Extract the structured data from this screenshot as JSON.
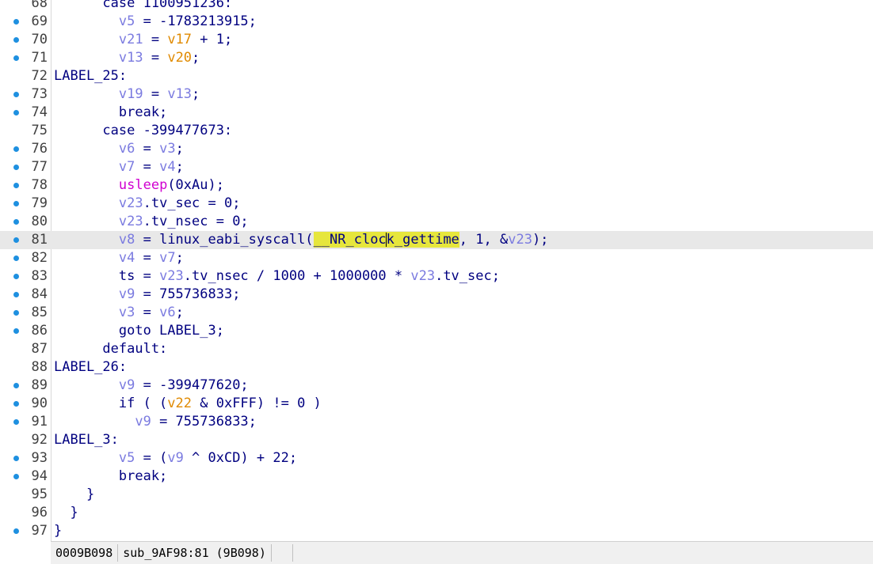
{
  "lines": [
    {
      "n": "68",
      "dot": false,
      "cur": false,
      "toks": [
        {
          "t": "      case 1100951236:",
          "c": ""
        }
      ]
    },
    {
      "n": "69",
      "dot": true,
      "cur": false,
      "toks": [
        {
          "t": "        ",
          "c": ""
        },
        {
          "t": "v5",
          "c": "ref"
        },
        {
          "t": " = -1783213915;",
          "c": ""
        }
      ]
    },
    {
      "n": "70",
      "dot": true,
      "cur": false,
      "toks": [
        {
          "t": "        ",
          "c": ""
        },
        {
          "t": "v21",
          "c": "ref"
        },
        {
          "t": " = ",
          "c": ""
        },
        {
          "t": "v17",
          "c": "val"
        },
        {
          "t": " + 1;",
          "c": ""
        }
      ]
    },
    {
      "n": "71",
      "dot": true,
      "cur": false,
      "toks": [
        {
          "t": "        ",
          "c": ""
        },
        {
          "t": "v13",
          "c": "ref"
        },
        {
          "t": " = ",
          "c": ""
        },
        {
          "t": "v20",
          "c": "val"
        },
        {
          "t": ";",
          "c": ""
        }
      ]
    },
    {
      "n": "72",
      "dot": false,
      "cur": false,
      "toks": [
        {
          "t": "LABEL_25:",
          "c": ""
        }
      ]
    },
    {
      "n": "73",
      "dot": true,
      "cur": false,
      "toks": [
        {
          "t": "        ",
          "c": ""
        },
        {
          "t": "v19",
          "c": "ref"
        },
        {
          "t": " = ",
          "c": ""
        },
        {
          "t": "v13",
          "c": "ref"
        },
        {
          "t": ";",
          "c": ""
        }
      ]
    },
    {
      "n": "74",
      "dot": true,
      "cur": false,
      "toks": [
        {
          "t": "        break;",
          "c": ""
        }
      ]
    },
    {
      "n": "75",
      "dot": false,
      "cur": false,
      "toks": [
        {
          "t": "      case -399477673:",
          "c": ""
        }
      ]
    },
    {
      "n": "76",
      "dot": true,
      "cur": false,
      "toks": [
        {
          "t": "        ",
          "c": ""
        },
        {
          "t": "v6",
          "c": "ref"
        },
        {
          "t": " = ",
          "c": ""
        },
        {
          "t": "v3",
          "c": "ref"
        },
        {
          "t": ";",
          "c": ""
        }
      ]
    },
    {
      "n": "77",
      "dot": true,
      "cur": false,
      "toks": [
        {
          "t": "        ",
          "c": ""
        },
        {
          "t": "v7",
          "c": "ref"
        },
        {
          "t": " = ",
          "c": ""
        },
        {
          "t": "v4",
          "c": "ref"
        },
        {
          "t": ";",
          "c": ""
        }
      ]
    },
    {
      "n": "78",
      "dot": true,
      "cur": false,
      "toks": [
        {
          "t": "        ",
          "c": ""
        },
        {
          "t": "usleep",
          "c": "fn"
        },
        {
          "t": "(0xAu);",
          "c": ""
        }
      ]
    },
    {
      "n": "79",
      "dot": true,
      "cur": false,
      "toks": [
        {
          "t": "        ",
          "c": ""
        },
        {
          "t": "v23",
          "c": "ref"
        },
        {
          "t": ".tv_sec = 0;",
          "c": ""
        }
      ]
    },
    {
      "n": "80",
      "dot": true,
      "cur": false,
      "toks": [
        {
          "t": "        ",
          "c": ""
        },
        {
          "t": "v23",
          "c": "ref"
        },
        {
          "t": ".tv_nsec = 0;",
          "c": ""
        }
      ]
    },
    {
      "n": "81",
      "dot": true,
      "cur": true,
      "toks": [
        {
          "t": "        ",
          "c": ""
        },
        {
          "t": "v8",
          "c": "ref"
        },
        {
          "t": " = linux_eabi_syscall(",
          "c": ""
        },
        {
          "t": "__NR_cloc",
          "c": "hl"
        },
        {
          "t": "|",
          "c": "cursor"
        },
        {
          "t": "k_gettime",
          "c": "hl"
        },
        {
          "t": ", 1, &",
          "c": ""
        },
        {
          "t": "v23",
          "c": "ref"
        },
        {
          "t": ");",
          "c": ""
        }
      ]
    },
    {
      "n": "82",
      "dot": true,
      "cur": false,
      "toks": [
        {
          "t": "        ",
          "c": ""
        },
        {
          "t": "v4",
          "c": "ref"
        },
        {
          "t": " = ",
          "c": ""
        },
        {
          "t": "v7",
          "c": "ref"
        },
        {
          "t": ";",
          "c": ""
        }
      ]
    },
    {
      "n": "83",
      "dot": true,
      "cur": false,
      "toks": [
        {
          "t": "        ts = ",
          "c": ""
        },
        {
          "t": "v23",
          "c": "ref"
        },
        {
          "t": ".tv_nsec / 1000 + 1000000 * ",
          "c": ""
        },
        {
          "t": "v23",
          "c": "ref"
        },
        {
          "t": ".tv_sec;",
          "c": ""
        }
      ]
    },
    {
      "n": "84",
      "dot": true,
      "cur": false,
      "toks": [
        {
          "t": "        ",
          "c": ""
        },
        {
          "t": "v9",
          "c": "ref"
        },
        {
          "t": " = 755736833;",
          "c": ""
        }
      ]
    },
    {
      "n": "85",
      "dot": true,
      "cur": false,
      "toks": [
        {
          "t": "        ",
          "c": ""
        },
        {
          "t": "v3",
          "c": "ref"
        },
        {
          "t": " = ",
          "c": ""
        },
        {
          "t": "v6",
          "c": "ref"
        },
        {
          "t": ";",
          "c": ""
        }
      ]
    },
    {
      "n": "86",
      "dot": true,
      "cur": false,
      "toks": [
        {
          "t": "        goto LABEL_3;",
          "c": ""
        }
      ]
    },
    {
      "n": "87",
      "dot": false,
      "cur": false,
      "toks": [
        {
          "t": "      default:",
          "c": ""
        }
      ]
    },
    {
      "n": "88",
      "dot": false,
      "cur": false,
      "toks": [
        {
          "t": "LABEL_26:",
          "c": ""
        }
      ]
    },
    {
      "n": "89",
      "dot": true,
      "cur": false,
      "toks": [
        {
          "t": "        ",
          "c": ""
        },
        {
          "t": "v9",
          "c": "ref"
        },
        {
          "t": " = -399477620;",
          "c": ""
        }
      ]
    },
    {
      "n": "90",
      "dot": true,
      "cur": false,
      "toks": [
        {
          "t": "        if ( (",
          "c": ""
        },
        {
          "t": "v22",
          "c": "val"
        },
        {
          "t": " & 0xFFF) != 0 )",
          "c": ""
        }
      ]
    },
    {
      "n": "91",
      "dot": true,
      "cur": false,
      "toks": [
        {
          "t": "          ",
          "c": ""
        },
        {
          "t": "v9",
          "c": "ref"
        },
        {
          "t": " = 755736833;",
          "c": ""
        }
      ]
    },
    {
      "n": "92",
      "dot": false,
      "cur": false,
      "toks": [
        {
          "t": "LABEL_3:",
          "c": ""
        }
      ]
    },
    {
      "n": "93",
      "dot": true,
      "cur": false,
      "toks": [
        {
          "t": "        ",
          "c": ""
        },
        {
          "t": "v5",
          "c": "ref"
        },
        {
          "t": " = (",
          "c": ""
        },
        {
          "t": "v9",
          "c": "ref"
        },
        {
          "t": " ^ 0xCD) + 22;",
          "c": ""
        }
      ]
    },
    {
      "n": "94",
      "dot": true,
      "cur": false,
      "toks": [
        {
          "t": "        break;",
          "c": ""
        }
      ]
    },
    {
      "n": "95",
      "dot": false,
      "cur": false,
      "toks": [
        {
          "t": "    }",
          "c": ""
        }
      ]
    },
    {
      "n": "96",
      "dot": false,
      "cur": false,
      "toks": [
        {
          "t": "  }",
          "c": ""
        }
      ]
    },
    {
      "n": "97",
      "dot": true,
      "cur": false,
      "toks": [
        {
          "t": "}",
          "c": ""
        }
      ]
    }
  ],
  "status": {
    "address": "0009B098",
    "location": "sub_9AF98:81 (9B098)"
  }
}
